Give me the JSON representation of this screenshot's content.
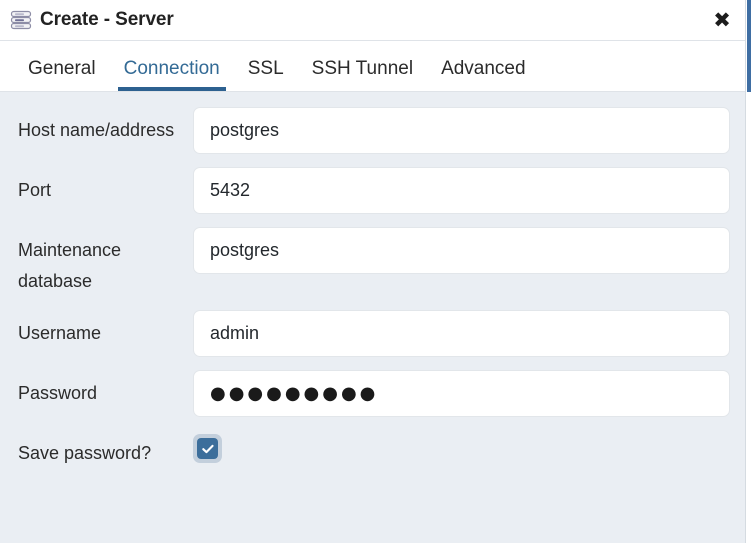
{
  "window": {
    "title": "Create - Server",
    "icon": "server-stack-icon",
    "close_label": "✖"
  },
  "tabs": [
    {
      "label": "General",
      "active": false
    },
    {
      "label": "Connection",
      "active": true
    },
    {
      "label": "SSL",
      "active": false
    },
    {
      "label": "SSH Tunnel",
      "active": false
    },
    {
      "label": "Advanced",
      "active": false
    }
  ],
  "form": {
    "fields": [
      {
        "label": "Host name/address",
        "name": "host-name-address",
        "type": "text",
        "value": "postgres",
        "placeholder": ""
      },
      {
        "label": "Port",
        "name": "port",
        "type": "text",
        "value": "5432",
        "placeholder": ""
      },
      {
        "label": "Maintenance database",
        "name": "maintenance-database",
        "type": "text",
        "value": "postgres",
        "placeholder": ""
      },
      {
        "label": "Username",
        "name": "username",
        "type": "text",
        "value": "admin",
        "placeholder": ""
      },
      {
        "label": "Password",
        "name": "password",
        "type": "password",
        "value": "●●●●●●●●●",
        "placeholder": ""
      },
      {
        "label": "Save password?",
        "name": "save-password",
        "type": "checkbox",
        "checked": true
      }
    ]
  },
  "colors": {
    "accent": "#2d6190",
    "tab_active_text": "#336a95",
    "checkbox_fill": "#3c6e9b",
    "checkbox_focus_ring": "#c3cfdc",
    "body_background": "#eaeef3",
    "panel_background": "#ffffff",
    "text": "#2b2b2b",
    "scrollbar_thumb": "#3f6ea3"
  }
}
